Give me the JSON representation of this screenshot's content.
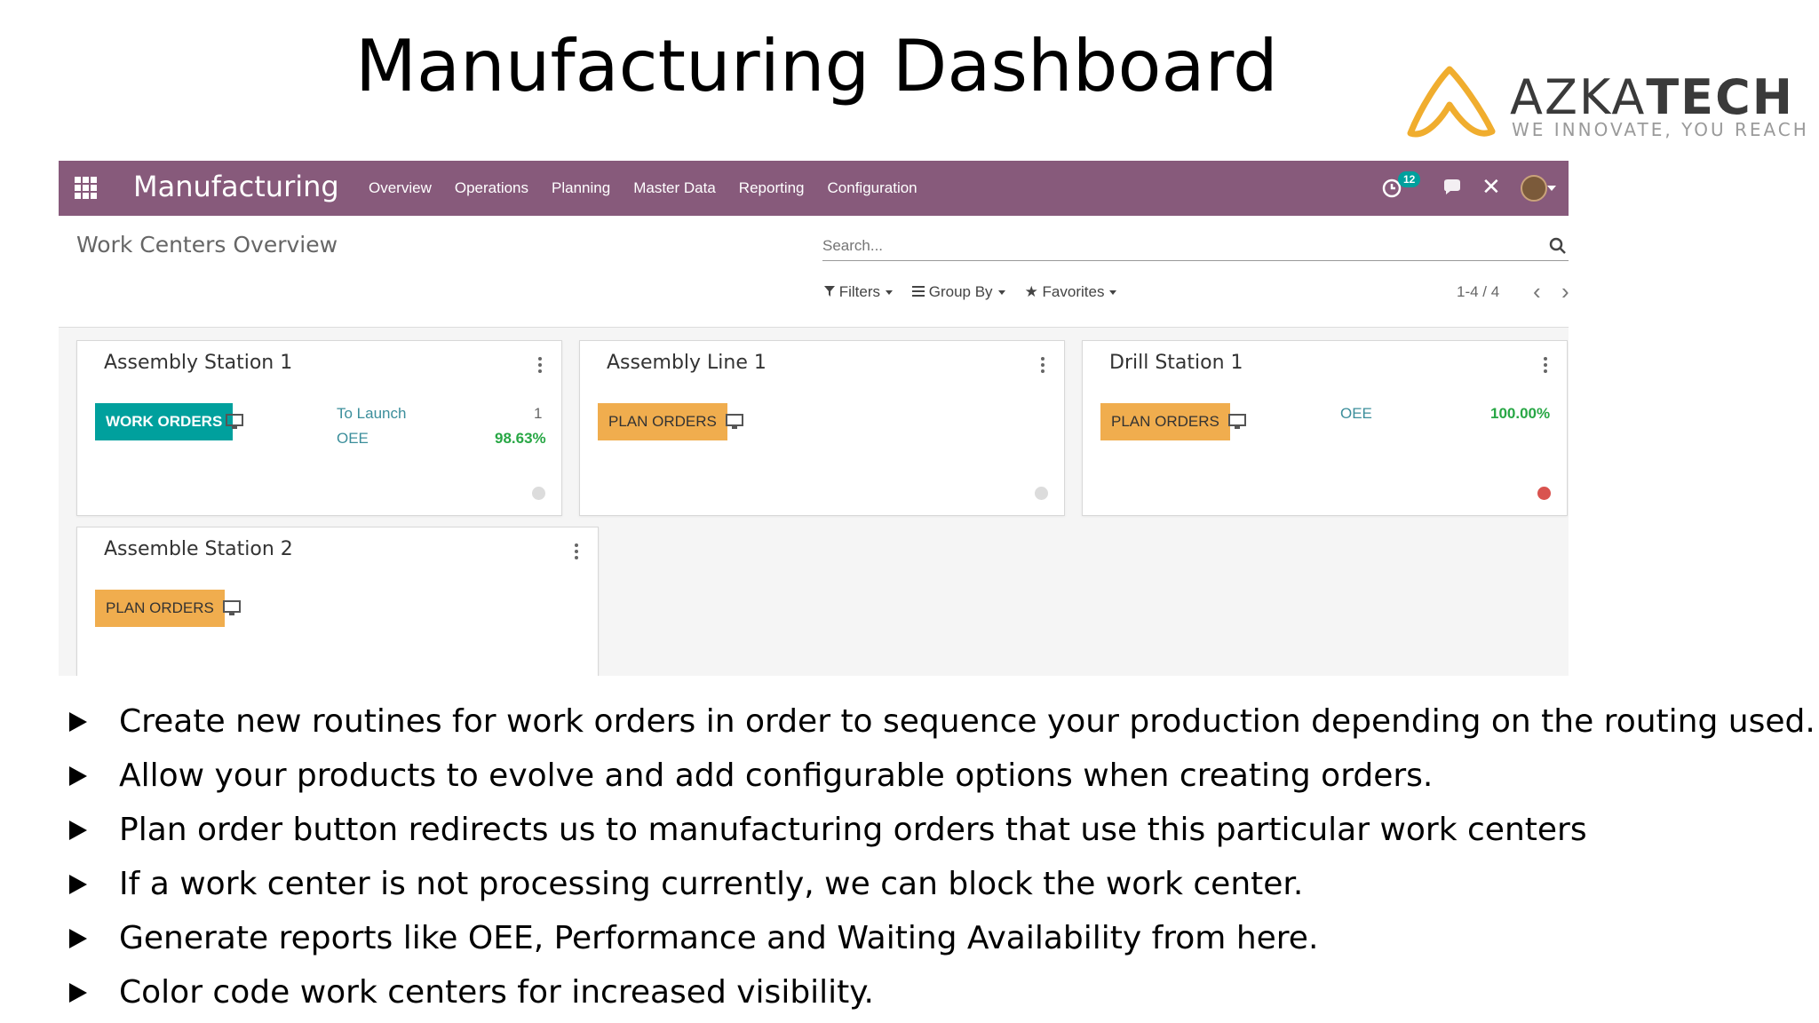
{
  "slide": {
    "title": "Manufacturing Dashboard",
    "logo": {
      "name_light": "AZKA",
      "name_bold": "TECH",
      "tagline": "WE INNOVATE, YOU REACH",
      "accent": "#f0ad2e"
    }
  },
  "app": {
    "brand": "Manufacturing",
    "nav_color": "#875a7b",
    "menu": [
      "Overview",
      "Operations",
      "Planning",
      "Master Data",
      "Reporting",
      "Configuration"
    ],
    "activity_count": "12",
    "breadcrumb": "Work Centers Overview",
    "search_placeholder": "Search...",
    "filters_label": "Filters",
    "groupby_label": "Group By",
    "favorites_label": "Favorites",
    "pager": "1-4 / 4"
  },
  "cards": [
    {
      "title": "Assembly Station 1",
      "button": "WORK ORDERS",
      "stat1_label": "To Launch",
      "stat1_value": "1",
      "stat2_label": "OEE",
      "stat2_value": "98.63%",
      "status": "grey"
    },
    {
      "title": "Assembly Line 1",
      "button": "PLAN ORDERS",
      "status": "grey"
    },
    {
      "title": "Drill Station 1",
      "button": "PLAN ORDERS",
      "stat1_label": "OEE",
      "stat1_value": "100.00%",
      "status": "red"
    },
    {
      "title": "Assemble Station 2",
      "button": "PLAN ORDERS"
    }
  ],
  "bullets": [
    "Create new routines for work orders in order to sequence your production depending on the routing used.",
    "Allow your products to evolve and add configurable options when creating orders.",
    "Plan order button redirects us to manufacturing orders that use this particular work centers",
    "If a work center is not processing currently, we can block the work center.",
    "Generate reports like OEE, Performance and Waiting Availability from here.",
    "Color code work centers for increased visibility."
  ]
}
